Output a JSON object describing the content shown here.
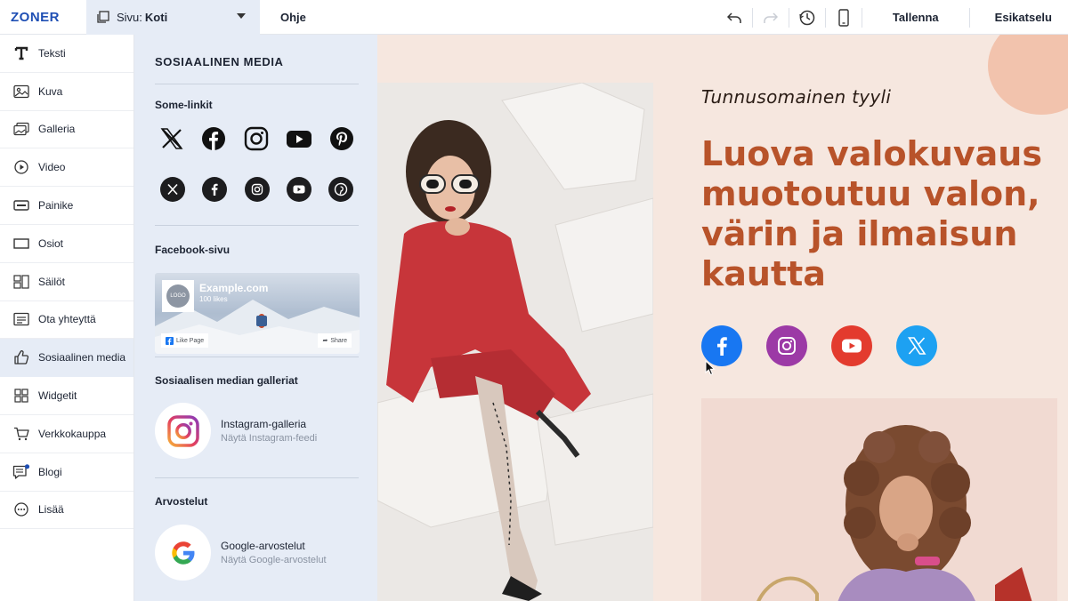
{
  "topbar": {
    "logo": "ZONER",
    "page_prefix": "Sivu:",
    "page_value": "Koti",
    "help": "Ohje",
    "save": "Tallenna",
    "preview": "Esikatselu"
  },
  "sidebar": {
    "items": [
      {
        "label": "Teksti",
        "icon": "text-icon"
      },
      {
        "label": "Kuva",
        "icon": "image-icon"
      },
      {
        "label": "Galleria",
        "icon": "gallery-icon"
      },
      {
        "label": "Video",
        "icon": "video-icon"
      },
      {
        "label": "Painike",
        "icon": "button-icon"
      },
      {
        "label": "Osiot",
        "icon": "sections-icon"
      },
      {
        "label": "Säilöt",
        "icon": "containers-icon"
      },
      {
        "label": "Ota yhteyttä",
        "icon": "contact-icon"
      },
      {
        "label": "Sosiaalinen media",
        "icon": "thumbs-up-icon"
      },
      {
        "label": "Widgetit",
        "icon": "widgets-icon"
      },
      {
        "label": "Verkkokauppa",
        "icon": "cart-icon"
      },
      {
        "label": "Blogi",
        "icon": "blog-icon"
      },
      {
        "label": "Lisää",
        "icon": "more-icon"
      }
    ]
  },
  "panel": {
    "title": "SOSIAALINEN MEDIA",
    "some_links": "Some-linkit",
    "facebook_page": "Facebook-sivu",
    "fb_card": {
      "logo": "LOGO",
      "name": "Example.com",
      "likes": "100 likes",
      "like_btn": "Like Page",
      "share_btn": "Share"
    },
    "galleries_title": "Sosiaalisen median galleriat",
    "instagram_gallery": {
      "name": "Instagram-galleria",
      "sub": "Näytä Instagram-feedi"
    },
    "reviews_title": "Arvostelut",
    "google_reviews": {
      "name": "Google-arvostelut",
      "sub": "Näytä Google-arvostelut"
    }
  },
  "canvas": {
    "tagline": "Tunnusomainen tyyli",
    "headline": "Luova valokuvaus muotoutuu valon, värin ja ilmaisun kautta"
  },
  "colors": {
    "accent": "#b8532a",
    "panel_bg": "#e6ecf6",
    "facebook": "#1877f2",
    "instagram": "#9c3aa6",
    "youtube": "#e33b2e",
    "x": "#1da1f2"
  }
}
